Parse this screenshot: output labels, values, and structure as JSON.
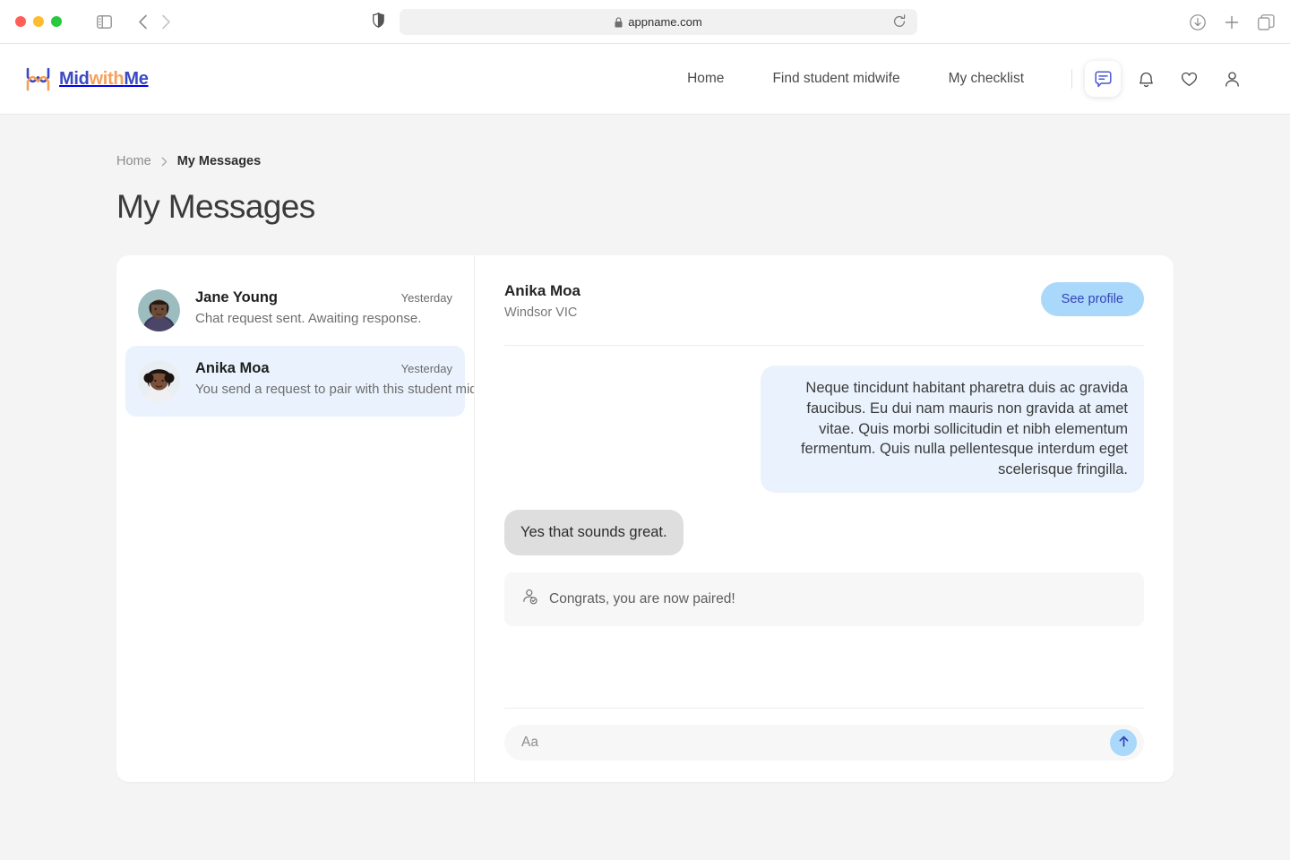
{
  "browser": {
    "url": "appname.com",
    "lock_icon": "lock-icon",
    "shield_icon": "shield-icon",
    "reload_icon": "reload-icon",
    "sidebar_icon": "sidebar-toggle-icon",
    "back_icon": "nav-back-icon",
    "forward_icon": "nav-forward-icon",
    "download_icon": "download-icon",
    "newtab_icon": "plus-icon",
    "tabs_icon": "tab-overview-icon"
  },
  "header": {
    "logo": {
      "mark": "midwithme-logo-mark",
      "part1": "Mid",
      "part2": "with",
      "part3": "Me",
      "color_blue": "#3b49c4",
      "color_orange": "#f5a05a"
    },
    "nav": [
      {
        "label": "Home"
      },
      {
        "label": "Find student midwife"
      },
      {
        "label": "My checklist"
      }
    ],
    "icons": [
      {
        "name": "messages-icon",
        "active": true
      },
      {
        "name": "bell-icon",
        "active": false
      },
      {
        "name": "heart-icon",
        "active": false
      },
      {
        "name": "account-icon",
        "active": false
      }
    ]
  },
  "breadcrumb": {
    "home": "Home",
    "separator": "chevron-right-icon",
    "current": "My Messages"
  },
  "page": {
    "title": "My Messages"
  },
  "conversations": [
    {
      "name": "Jane Young",
      "time": "Yesterday",
      "preview": "Chat request sent. Awaiting response.",
      "selected": false
    },
    {
      "name": "Anika Moa",
      "time": "Yesterday",
      "preview": "You send a request to pair with this student midwife.",
      "selected": true
    }
  ],
  "chat": {
    "peer_name": "Anika Moa",
    "peer_location": "Windsor VIC",
    "see_profile_label": "See profile",
    "see_profile_bg": "#aad8fb",
    "see_profile_color": "#3444b8",
    "messages": [
      {
        "direction": "out",
        "text": "Neque tincidunt habitant pharetra duis ac gravida faucibus. Eu dui nam mauris non gravida at amet vitae. Quis morbi sollicitudin et nibh elementum fermentum. Quis nulla pellentesque interdum eget scelerisque fringilla."
      },
      {
        "direction": "in",
        "text": "Yes that sounds great."
      }
    ],
    "system_notice": {
      "icon": "user-paired-icon",
      "text": "Congrats, you are now paired!"
    },
    "composer": {
      "placeholder": "Aa",
      "value": "",
      "send_icon": "arrow-up-icon",
      "send_bg": "#a9d8fa"
    }
  }
}
